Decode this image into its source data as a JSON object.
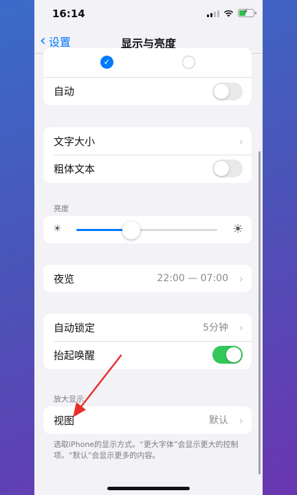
{
  "status_bar": {
    "time": "16:14"
  },
  "nav": {
    "back_label": "设置",
    "title": "显示与亮度"
  },
  "appearance": {
    "auto_label": "自动",
    "auto_on": false,
    "light_selected": true
  },
  "text_section": {
    "text_size_label": "文字大小",
    "bold_text_label": "粗体文本",
    "bold_on": false
  },
  "brightness": {
    "section_label": "亮度",
    "level": 0.39
  },
  "night_shift": {
    "label": "夜览",
    "value": "22:00 — 07:00"
  },
  "lock_section": {
    "auto_lock_label": "自动锁定",
    "auto_lock_value": "5分钟",
    "raise_to_wake_label": "抬起唤醒",
    "raise_to_wake_on": true
  },
  "zoom": {
    "section_label": "放大显示",
    "view_label": "视图",
    "view_value": "默认",
    "footnote": "选取iPhone的显示方式。“更大字体”会显示更大的控制项。“默认”会显示更多的内容。"
  },
  "colors": {
    "accent": "#007aff",
    "toggle_on": "#34c759",
    "annotation_arrow": "#e8302a"
  }
}
